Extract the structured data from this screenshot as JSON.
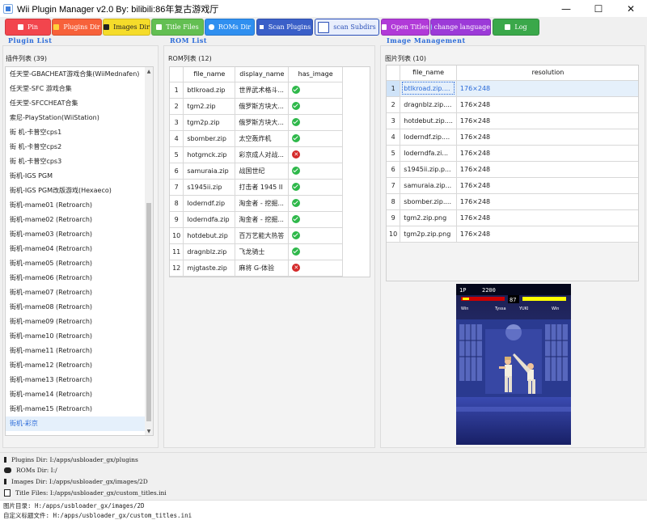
{
  "window": {
    "title": "Wii Plugin Manager v2.0 By: bilibili:86年复古游戏厅",
    "minimize": "—",
    "maximize": "☐",
    "close": "✕"
  },
  "toolbar": {
    "pin": "Pin",
    "plugins_dir": "Plugins Dir",
    "images_dir": "Images Dir",
    "title_files": "Title Files",
    "roms_dir": "ROMs Dir",
    "scan_plugins": "Scan Plugins",
    "scan_subdirs": "scan Subdirs",
    "open_titles": "Open Titles",
    "change_language": "change language",
    "log": "Log"
  },
  "plugin_section": {
    "label": "Plugin List",
    "caption": "插件列表 (39)",
    "items": [
      "任天堂-GBACHEAT游戏合集(WiiMednafen)",
      "任天堂-SFC 游戏合集",
      "任天堂-SFCCHEAT合集",
      "索尼-PlayStation(WiiStation)",
      "街 机-卡普空cps1",
      "街 机-卡普空cps2",
      "街 机-卡普空cps3",
      "街机-IGS PGM",
      "街机-IGS PGM改版游戏(Hexaeco)",
      "街机-mame01 (Retroarch)",
      "街机-mame02 (Retroarch)",
      "街机-mame03 (Retroarch)",
      "街机-mame04 (Retroarch)",
      "街机-mame05 (Retroarch)",
      "街机-mame06 (Retroarch)",
      "街机-mame07 (Retroarch)",
      "街机-mame08 (Retroarch)",
      "街机-mame09 (Retroarch)",
      "街机-mame10 (Retroarch)",
      "街机-mame11 (Retroarch)",
      "街机-mame12 (Retroarch)",
      "街机-mame13 (Retroarch)",
      "街机-mame14 (Retroarch)",
      "街机-mame15 (Retroarch)",
      "街机-彩京"
    ],
    "selected_index": 24
  },
  "rom_section": {
    "label": "ROM List",
    "caption": "ROM列表 (12)",
    "columns": [
      "file_name",
      "display_name",
      "has_image"
    ],
    "rows": [
      {
        "n": "1",
        "file": "btlkroad.zip",
        "display": "世界武术格斗...",
        "has_image": true
      },
      {
        "n": "2",
        "file": "tgm2.zip",
        "display": "俄罗斯方块大...",
        "has_image": true
      },
      {
        "n": "3",
        "file": "tgm2p.zip",
        "display": "俄罗斯方块大...",
        "has_image": true
      },
      {
        "n": "4",
        "file": "sbomber.zip",
        "display": "太空轰炸机",
        "has_image": true
      },
      {
        "n": "5",
        "file": "hotgmck.zip",
        "display": "彩京成人对战...",
        "has_image": false
      },
      {
        "n": "6",
        "file": "samuraia.zip",
        "display": "战国世纪",
        "has_image": true
      },
      {
        "n": "7",
        "file": "s1945ii.zip",
        "display": "打击者 1945 II",
        "has_image": true
      },
      {
        "n": "8",
        "file": "loderndf.zip",
        "display": "淘金者 - 挖掘...",
        "has_image": true
      },
      {
        "n": "9",
        "file": "loderndfa.zip",
        "display": "淘金者 - 挖掘...",
        "has_image": true
      },
      {
        "n": "10",
        "file": "hotdebut.zip",
        "display": "百万艺能大热答",
        "has_image": true
      },
      {
        "n": "11",
        "file": "dragnblz.zip",
        "display": "飞龙骑士",
        "has_image": true
      },
      {
        "n": "12",
        "file": "mjgtaste.zip",
        "display": "麻将 G-体验",
        "has_image": false
      }
    ]
  },
  "image_section": {
    "label": "Image Management",
    "caption": "图片列表 (10)",
    "columns": [
      "file_name",
      "resolution"
    ],
    "rows": [
      {
        "n": "1",
        "file": "btlkroad.zip....",
        "res": "176×248"
      },
      {
        "n": "2",
        "file": "dragnblz.zip....",
        "res": "176×248"
      },
      {
        "n": "3",
        "file": "hotdebut.zip....",
        "res": "176×248"
      },
      {
        "n": "4",
        "file": "loderndf.zip....",
        "res": "176×248"
      },
      {
        "n": "5",
        "file": "loderndfa.zi...",
        "res": "176×248"
      },
      {
        "n": "6",
        "file": "s1945ii.zip.p...",
        "res": "176×248"
      },
      {
        "n": "7",
        "file": "samuraia.zip...",
        "res": "176×248"
      },
      {
        "n": "8",
        "file": "sbomber.zip....",
        "res": "176×248"
      },
      {
        "n": "9",
        "file": "tgm2.zip.png",
        "res": "176×248"
      },
      {
        "n": "10",
        "file": "tgm2p.zip.png",
        "res": "176×248"
      }
    ]
  },
  "preview": {
    "p1_label": "1P",
    "score": "2200",
    "timer": "87",
    "p1_name": "Tyssa",
    "p2_name": "YUKI",
    "win_left": "Win",
    "win_right": "Win"
  },
  "info": {
    "plugins_dir": "Plugins Dir: I:/apps/usbloader_gx/plugins",
    "roms_dir": "ROMs Dir: I:/",
    "images_dir": "Images Dir: I:/apps/usbloader_gx/images/2D",
    "title_files": "Title Files: I:/apps/usbloader_gx/custom_titles.ini"
  },
  "status": {
    "images_path": "图片目录: H:/apps/usbloader_gx/images/2D",
    "titles_file": "自定义标题文件: H:/apps/usbloader_gx/custom_titles.ini"
  },
  "colors": {
    "pin": "#f2454d",
    "plugins_dir": "#f7613a",
    "images_dir": "#f5dc2a",
    "title_files": "#63bf52",
    "roms_dir": "#2f8ff0",
    "scan_plugins": "#3a5fc8",
    "scan_subdirs": "#e8eefc",
    "open_titles": "#b13ad8",
    "change_language": "#9c3ad8",
    "log": "#3aa84a",
    "accent": "#2a6ad8"
  }
}
